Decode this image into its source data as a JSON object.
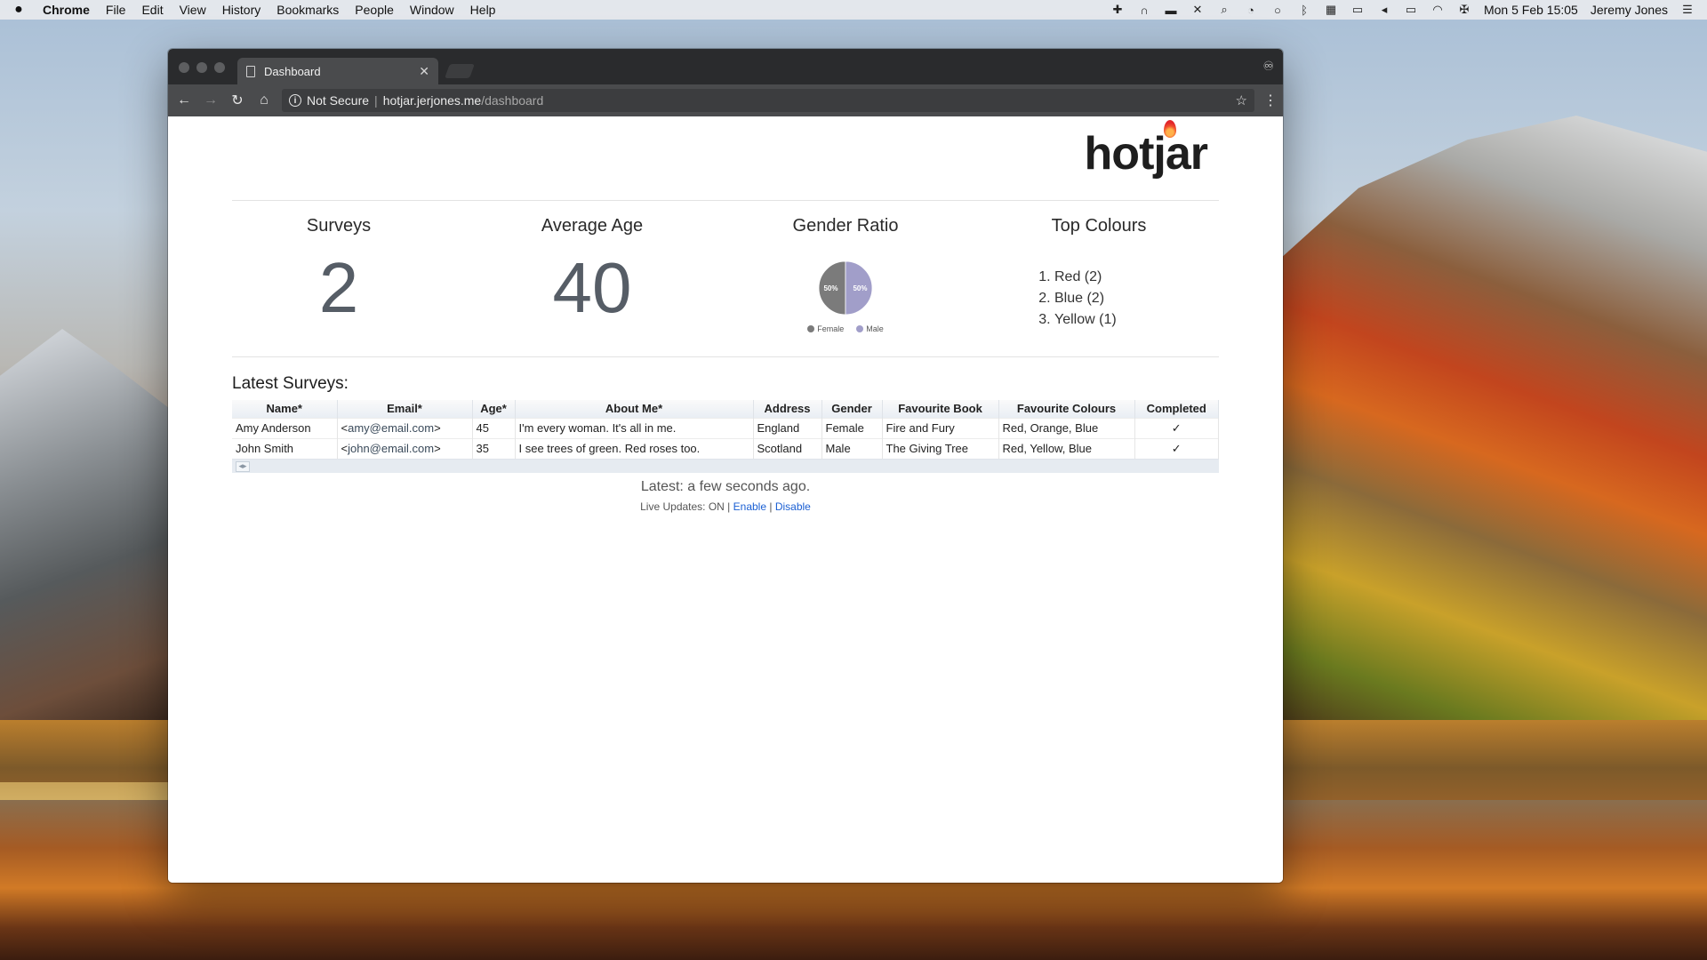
{
  "menubar": {
    "app": "Chrome",
    "items": [
      "File",
      "Edit",
      "View",
      "History",
      "Bookmarks",
      "People",
      "Window",
      "Help"
    ],
    "datetime": "Mon 5 Feb  15:05",
    "user": "Jeremy Jones"
  },
  "browser": {
    "tab_title": "Dashboard",
    "security_label": "Not Secure",
    "url_host": "hotjar.jerjones.me",
    "url_path": "/dashboard"
  },
  "page": {
    "logo": "hotjar",
    "stats": {
      "surveys_label": "Surveys",
      "surveys_value": "2",
      "avg_age_label": "Average Age",
      "avg_age_value": "40",
      "gender_label": "Gender Ratio",
      "top_colours_label": "Top Colours",
      "top_colours": [
        "Red (2)",
        "Blue (2)",
        "Yellow (1)"
      ]
    },
    "latest_title": "Latest Surveys:",
    "table": {
      "headers": [
        "Name*",
        "Email*",
        "Age*",
        "About Me*",
        "Address",
        "Gender",
        "Favourite Book",
        "Favourite Colours",
        "Completed"
      ],
      "rows": [
        {
          "name": "Amy Anderson",
          "email": "amy@email.com",
          "age": "45",
          "about": "I'm every woman. It's all in me.",
          "address": "England",
          "gender": "Female",
          "book": "Fire and Fury",
          "colours": "Red, Orange, Blue",
          "completed": "✓"
        },
        {
          "name": "John Smith",
          "email": "john@email.com",
          "age": "35",
          "about": "I see trees of green. Red roses too.",
          "address": "Scotland",
          "gender": "Male",
          "book": "The Giving Tree",
          "colours": "Red, Yellow, Blue",
          "completed": "✓"
        }
      ]
    },
    "latest_update": "Latest: a few seconds ago.",
    "live_updates_text": "Live Updates: ON |",
    "enable_label": "Enable",
    "pipe": "|",
    "disable_label": "Disable"
  },
  "chart_data": {
    "type": "pie",
    "categories": [
      "Female",
      "Male"
    ],
    "values": [
      50,
      50
    ],
    "data_labels": [
      "50%",
      "50%"
    ],
    "colors": [
      "#7b7b7b",
      "#a19ec9"
    ],
    "legend": "bottom"
  }
}
